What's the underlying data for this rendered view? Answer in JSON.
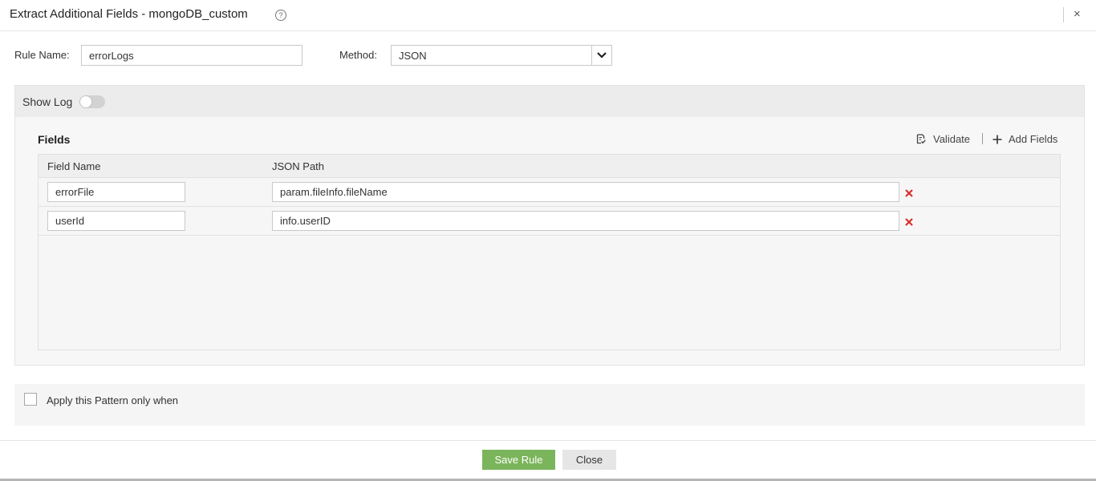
{
  "dialog": {
    "title": "Extract Additional Fields - mongoDB_custom",
    "help_icon": "?",
    "close_icon": "×"
  },
  "form": {
    "rule_name_label": "Rule Name:",
    "rule_name_value": "errorLogs",
    "method_label": "Method:",
    "method_value": "JSON"
  },
  "log_panel": {
    "show_log_label": "Show Log",
    "show_log_on": false
  },
  "fields": {
    "title": "Fields",
    "validate_label": "Validate",
    "add_fields_label": "Add Fields",
    "columns": [
      "Field Name",
      "JSON Path"
    ],
    "rows": [
      {
        "field_name": "errorFile",
        "json_path": "param.fileInfo.fileName"
      },
      {
        "field_name": "userId",
        "json_path": "info.userID"
      }
    ]
  },
  "apply_condition": {
    "label": "Apply this Pattern only when",
    "checked": false
  },
  "buttons": {
    "save": "Save Rule",
    "close": "Close"
  },
  "colors": {
    "save_button": "#7bb55b",
    "delete_icon": "#d9302c",
    "panel_bg": "#f7f7f7"
  }
}
